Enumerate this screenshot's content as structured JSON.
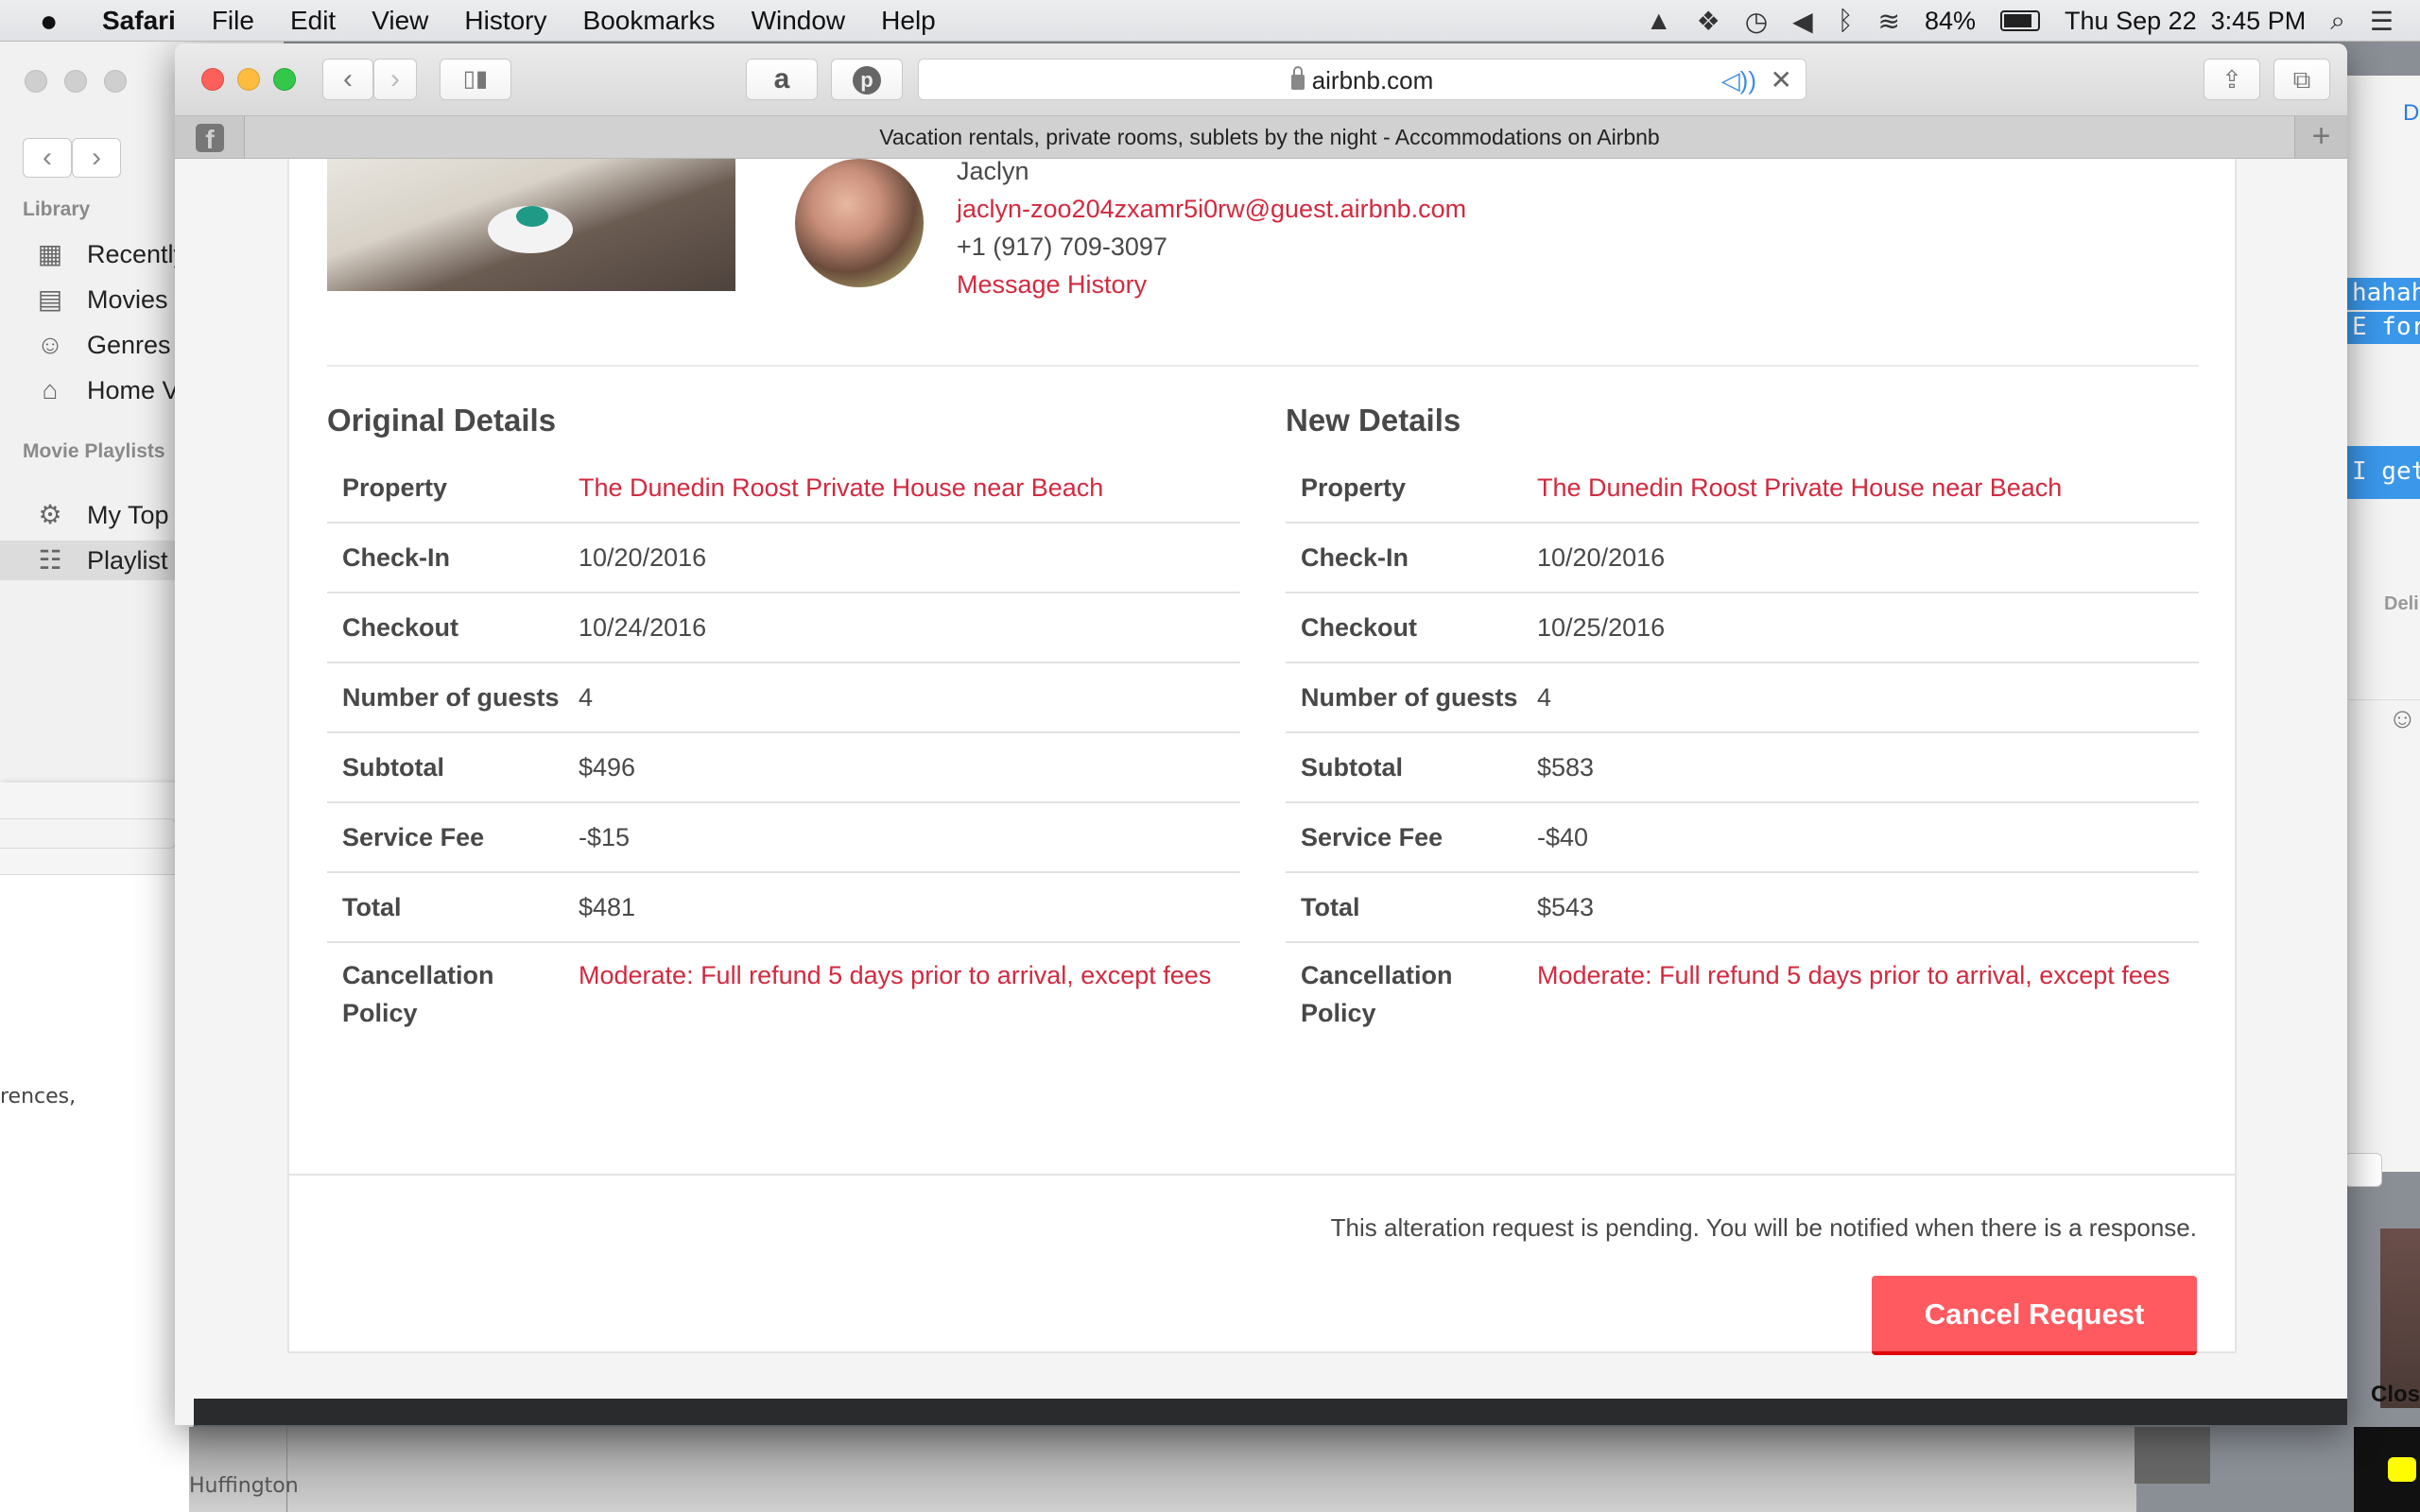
{
  "menubar": {
    "app": "Safari",
    "items": [
      "File",
      "Edit",
      "View",
      "History",
      "Bookmarks",
      "Window",
      "Help"
    ],
    "battery": "84%",
    "battery_level": 0.84,
    "datetime": "Thu Sep 22  3:45 PM"
  },
  "itunes": {
    "library_label": "Library",
    "library_items": [
      {
        "label": "Recently",
        "icon": "grid-icon"
      },
      {
        "label": "Movies",
        "icon": "film-icon"
      },
      {
        "label": "Genres",
        "icon": "masks-icon"
      },
      {
        "label": "Home V",
        "icon": "home-video-icon"
      }
    ],
    "playlists_label": "Movie Playlists",
    "playlist_items": [
      {
        "label": "My Top",
        "icon": "gear-icon"
      },
      {
        "label": "Playlist",
        "icon": "playlist-icon",
        "selected": true
      }
    ]
  },
  "prefs_window": {
    "visible_text": "rences,"
  },
  "messages": {
    "header_fragment": "D",
    "bubbles": [
      "hahaha",
      "E for th",
      "I get"
    ],
    "status_fragment": "Deli"
  },
  "bottom": {
    "huffington_tab": "Huffington",
    "close_label": "Close"
  },
  "safari": {
    "url": "airbnb.com",
    "tab_title": "Vacation rentals, private rooms, sublets by the night - Accommodations on Airbnb"
  },
  "guest": {
    "name": "Jaclyn",
    "email": "jaclyn-zoo204zxamr5i0rw@guest.airbnb.com",
    "phone": "+1 (917) 709-3097",
    "message_history": "Message History"
  },
  "original": {
    "title": "Original Details",
    "rows": [
      {
        "label": "Property",
        "value": "The Dunedin Roost Private House near Beach",
        "link": true
      },
      {
        "label": "Check-In",
        "value": "10/20/2016"
      },
      {
        "label": "Checkout",
        "value": "10/24/2016"
      },
      {
        "label": "Number of guests",
        "value": "4"
      },
      {
        "label": "Subtotal",
        "value": "$496"
      },
      {
        "label": "Service Fee",
        "value": "-$15"
      },
      {
        "label": "Total",
        "value": "$481"
      },
      {
        "label": "Cancellation Policy",
        "value": "Moderate: Full refund 5 days prior to arrival, except fees",
        "link": true
      }
    ]
  },
  "new": {
    "title": "New Details",
    "rows": [
      {
        "label": "Property",
        "value": "The Dunedin Roost Private House near Beach",
        "link": true
      },
      {
        "label": "Check-In",
        "value": "10/20/2016"
      },
      {
        "label": "Checkout",
        "value": "10/25/2016"
      },
      {
        "label": "Number of guests",
        "value": "4"
      },
      {
        "label": "Subtotal",
        "value": "$583"
      },
      {
        "label": "Service Fee",
        "value": "-$40"
      },
      {
        "label": "Total",
        "value": "$543"
      },
      {
        "label": "Cancellation Policy",
        "value": "Moderate: Full refund 5 days prior to arrival, except fees",
        "link": true
      }
    ]
  },
  "footer": {
    "pending_text": "This alteration request is pending. You will be notified when there is a response.",
    "cancel_label": "Cancel Request"
  },
  "colors": {
    "brand_red": "#ff5a5f",
    "link_red": "#d2293f",
    "text": "#484848"
  }
}
